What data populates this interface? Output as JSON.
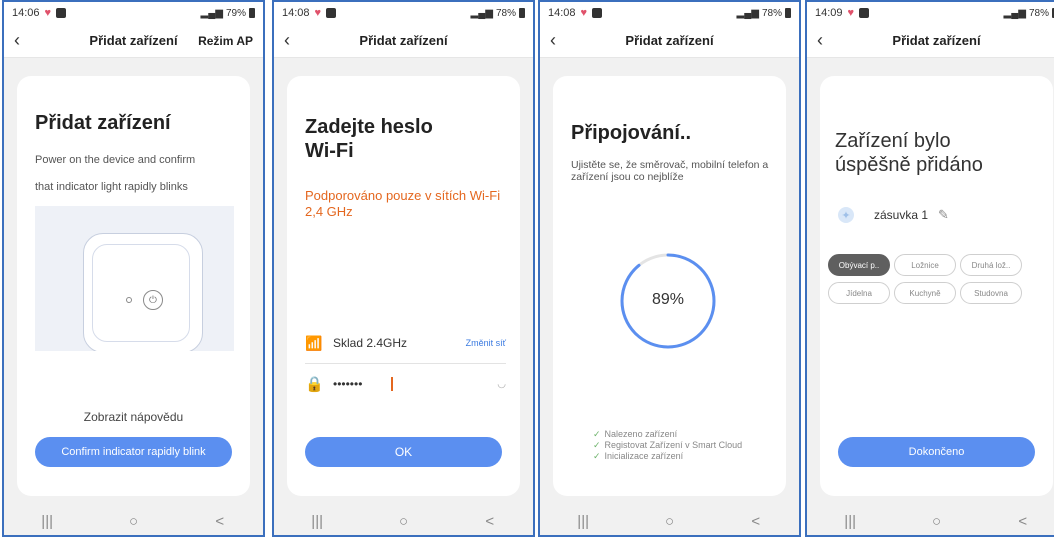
{
  "colors": {
    "accent": "#5b8ff0",
    "warning": "#e4671f",
    "frame": "#3b6fbd",
    "progress": "#5b8ff0"
  },
  "sysnav": {
    "recent": "|||",
    "home": "○",
    "back": "<"
  },
  "screens": [
    {
      "status": {
        "time": "14:06",
        "battery": "79%"
      },
      "nav": {
        "title": "Přidat zařízení",
        "right": "Režim AP"
      },
      "title": "Přidat zařízení",
      "instructions": [
        "Power on the device and confirm",
        "that indicator light rapidly blinks"
      ],
      "help_link": "Zobrazit nápovědu",
      "button": "Confirm indicator rapidly blink"
    },
    {
      "status": {
        "time": "14:08",
        "battery": "78%"
      },
      "nav": {
        "title": "Přidat zařízení"
      },
      "title_line1": "Zadejte heslo",
      "title_line2": "Wi-Fi",
      "note": "Podporováno pouze v sítích Wi-Fi 2,4 GHz",
      "wifi_name": "Sklad 2.4GHz",
      "change_network": "Změnit síť",
      "password_value": "•••••••",
      "button": "OK"
    },
    {
      "status": {
        "time": "14:08",
        "battery": "78%"
      },
      "nav": {
        "title": "Přidat zařízení"
      },
      "title": "Připojování..",
      "subtitle": "Ujistěte se, že směrovač, mobilní telefon a zařízení jsou co nejblíže",
      "progress_percent": 89,
      "progress_label": "89%",
      "steps": [
        "Nalezeno zařízení",
        "Registovat Zařízení v Smart Cloud",
        "Inicializace zařízení"
      ]
    },
    {
      "status": {
        "time": "14:09",
        "battery": "78%"
      },
      "nav": {
        "title": "Přidat zařízení"
      },
      "title_line1": "Zařízení bylo",
      "title_line2": "úspěšně přidáno",
      "device_name": "zásuvka 1",
      "rooms_row1": [
        "Obývací p..",
        "Ložnice",
        "Druhá lož.."
      ],
      "rooms_row2": [
        "Jídelna",
        "Kuchyně",
        "Studovna"
      ],
      "button": "Dokončeno"
    }
  ]
}
